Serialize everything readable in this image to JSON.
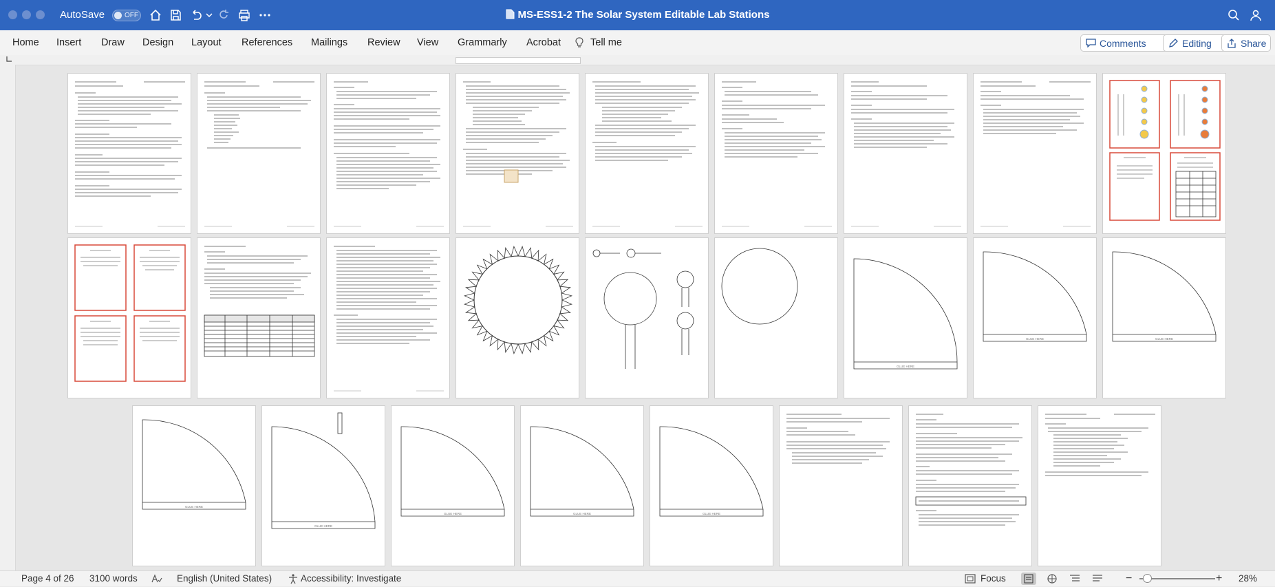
{
  "titlebar": {
    "autosave_label": "AutoSave",
    "autosave_state": "OFF",
    "doc_title": "MS-ESS1-2 The Solar System Editable Lab Stations",
    "accent_color": "#2f66c0"
  },
  "ribbon": {
    "tabs": [
      "Home",
      "Insert",
      "Draw",
      "Design",
      "Layout",
      "References",
      "Mailings",
      "Review",
      "View",
      "Grammarly",
      "Acrobat"
    ],
    "tell_me": "Tell me",
    "comments_label": "Comments",
    "editing_label": "Editing",
    "share_label": "Share"
  },
  "status": {
    "page_info": "Page 4 of 26",
    "word_count": "3100 words",
    "language": "English (United States)",
    "accessibility": "Accessibility: Investigate",
    "focus_label": "Focus",
    "zoom": "28%"
  },
  "pages": {
    "glue_label": "GLUE HERE"
  }
}
